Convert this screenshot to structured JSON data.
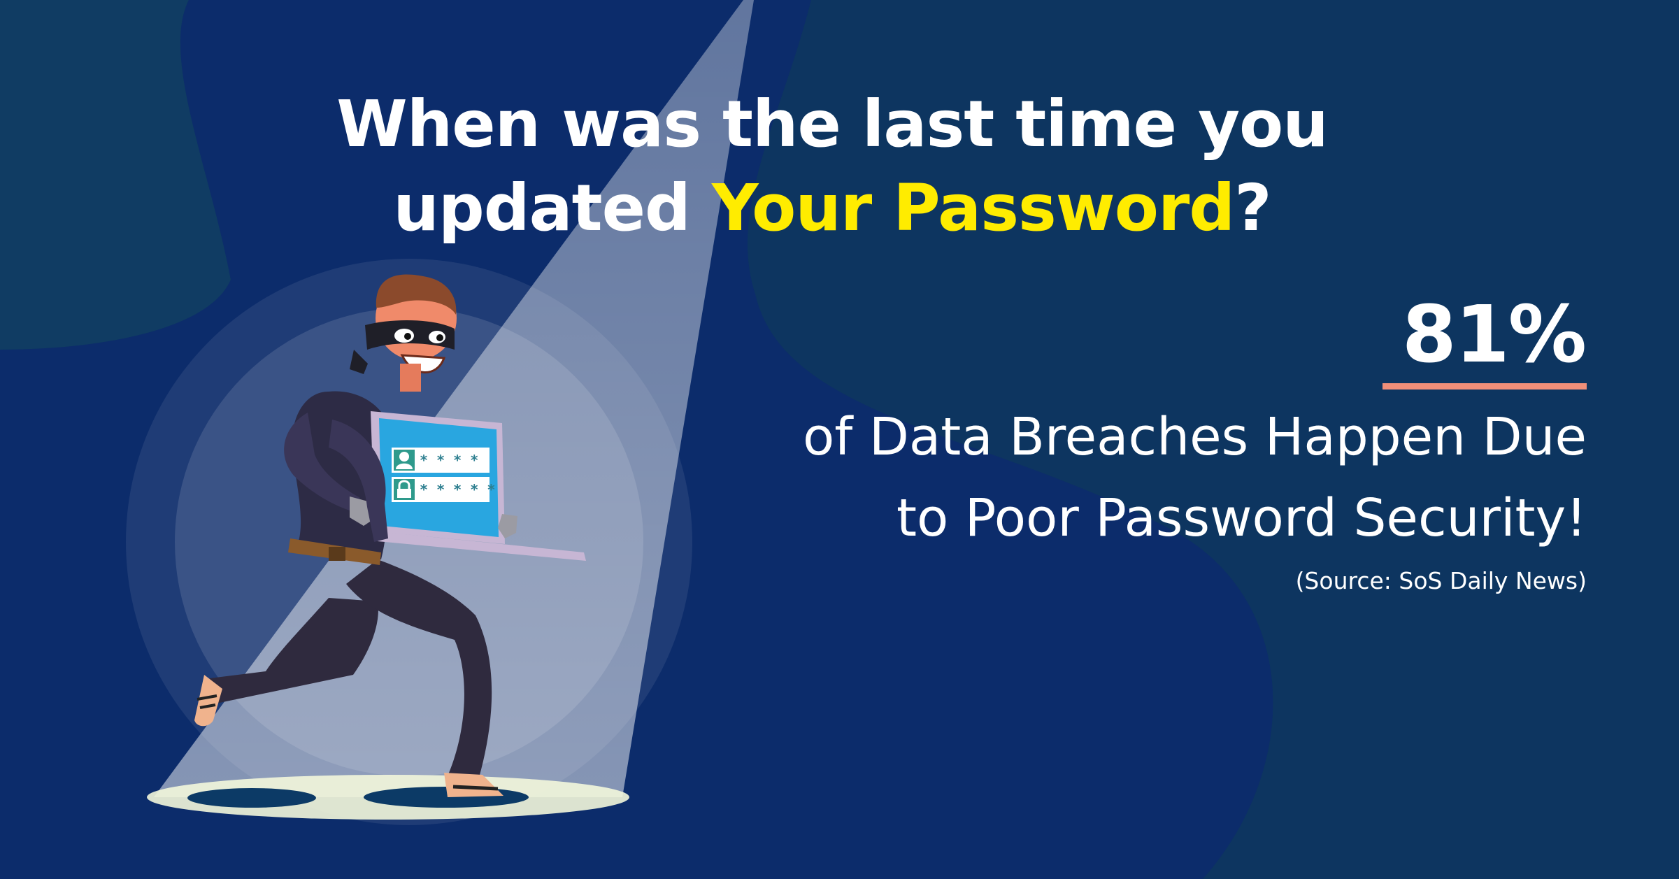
{
  "headline": {
    "line1": "When was the last time you",
    "line2_prefix": "updated ",
    "line2_highlight": "Your Password",
    "line2_suffix": "?"
  },
  "stat": {
    "value": "81%",
    "description_line1": "of Data Breaches Happen Due",
    "description_line2": "to Poor Password Security!",
    "source": "(Source: SoS Daily News)"
  },
  "illustration": {
    "subject": "masked thief carrying laptop under spotlight",
    "icons": [
      "user-icon",
      "lock-icon"
    ],
    "password_mask_row1": "* * * *",
    "password_mask_row2": "* * * * *"
  },
  "colors": {
    "background": "#0b3763",
    "highlight_yellow": "#ffec00",
    "underline_salmon": "#f08f79",
    "text_white": "#ffffff",
    "laptop_screen": "#29a6e0"
  }
}
